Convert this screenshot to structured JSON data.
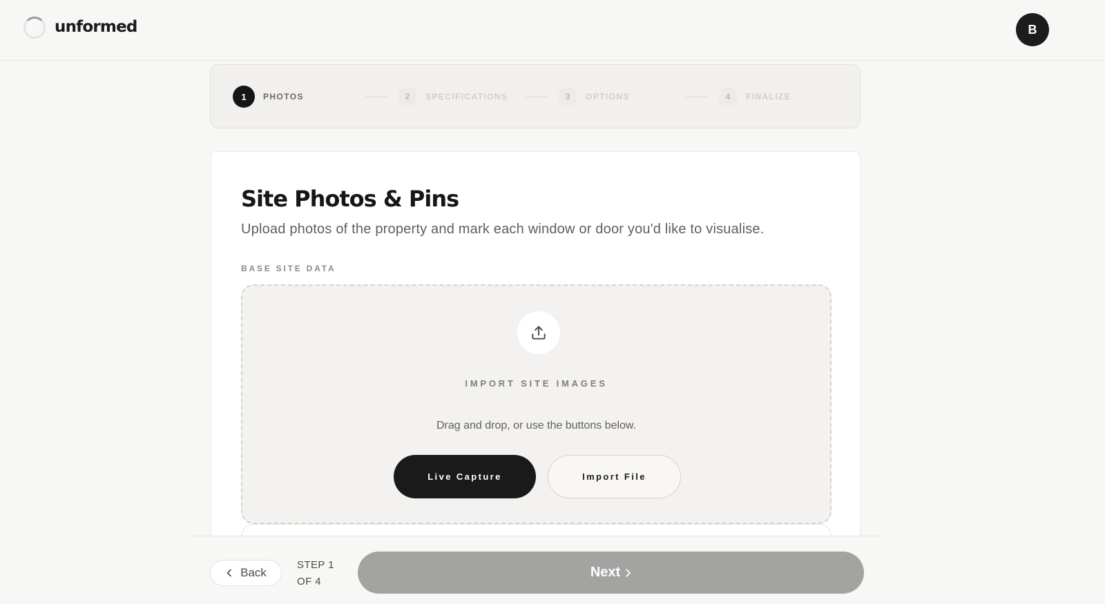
{
  "header": {
    "brand": "unformed",
    "avatar_initial": "B"
  },
  "stepper": {
    "steps": [
      {
        "number": "1",
        "label": "PHOTOS",
        "state": "active"
      },
      {
        "number": "2",
        "label": "SPECIFICATIONS",
        "state": "inactive"
      },
      {
        "number": "3",
        "label": "OPTIONS",
        "state": "inactive"
      },
      {
        "number": "4",
        "label": "FINALIZE",
        "state": "inactive"
      }
    ]
  },
  "main": {
    "title": "Site Photos & Pins",
    "subtitle": "Upload photos of the property and mark each window or door you'd like to visualise.",
    "section_label": "BASE SITE DATA",
    "dropzone": {
      "icon": "upload-icon",
      "heading": "IMPORT SITE IMAGES",
      "hint": "Drag and drop, or use the buttons below.",
      "live_capture_label": "Live Capture",
      "import_file_label": "Import File"
    }
  },
  "footer": {
    "back_label": "Back",
    "step_line1": "STEP 1",
    "step_line2": "OF 4",
    "next_label": "Next"
  },
  "colors": {
    "background": "#f7f7f6",
    "primary_button": "#1a1a1a",
    "disabled_button": "#a3a3a2",
    "stepper_bg": "#f1f0ee"
  }
}
